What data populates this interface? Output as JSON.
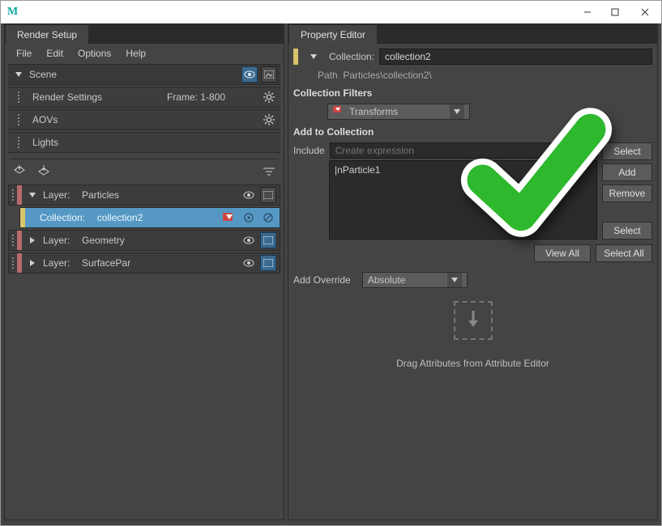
{
  "titlebar": {
    "app_glyph": "M"
  },
  "left": {
    "tab": "Render Setup",
    "menu": [
      "File",
      "Edit",
      "Options",
      "Help"
    ],
    "scene_label": "Scene",
    "render_settings": "Render Settings",
    "frame_range": "Frame: 1-800",
    "aovs": "AOVs",
    "lights": "Lights",
    "layer_prefix": "Layer:",
    "collection_prefix": "Collection:",
    "layers": [
      {
        "name": "Particles"
      },
      {
        "name": "Geometry"
      },
      {
        "name": "SurfacePar"
      }
    ],
    "collection_name": "collection2"
  },
  "right": {
    "tab": "Property Editor",
    "collection_prefix": "Collection:",
    "collection_name": "collection2",
    "path_label": "Path",
    "path_value": "Particles\\collection2\\",
    "filters_label": "Collection Filters",
    "filter_value": "Transforms",
    "add_label": "Add to Collection",
    "include_label": "Include",
    "include_placeholder": "Create expression",
    "list_item": "|nParticle1",
    "btn_select": "Select",
    "btn_add": "Add",
    "btn_remove": "Remove",
    "btn_viewall": "View All",
    "btn_selectall": "Select All",
    "override_label": "Add Override",
    "override_value": "Absolute",
    "drop_text": "Drag Attributes from Attribute Editor"
  }
}
